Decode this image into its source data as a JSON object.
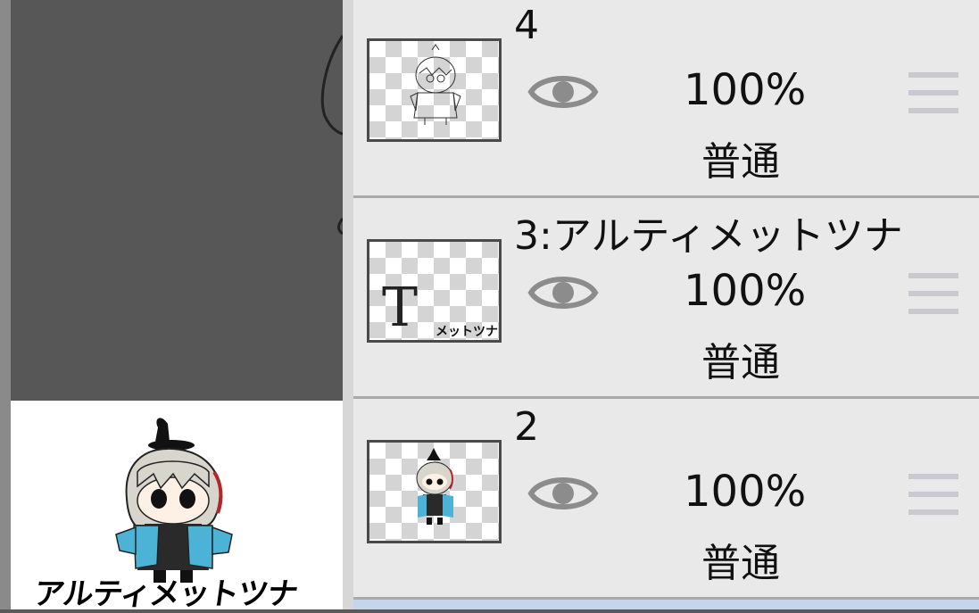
{
  "preview": {
    "caption": "アルティメットツナ"
  },
  "layers": [
    {
      "name": "4",
      "opacity": "100%",
      "blend": "普通",
      "thumb_icon": "sketch-thumbnail"
    },
    {
      "name": "3:アルティメットツナ",
      "opacity": "100%",
      "blend": "普通",
      "thumb_icon": "text-layer-thumbnail",
      "thumb_letter": "T",
      "thumb_text": "メットツナ"
    },
    {
      "name": "2",
      "opacity": "100%",
      "blend": "普通",
      "thumb_icon": "character-thumbnail"
    }
  ],
  "icons": {
    "visibility": "eye-icon",
    "reorder": "drag-handle-icon"
  },
  "colors": {
    "panel_bg": "#e9e9e9",
    "canvas_bg": "#575757",
    "selected_row": "#c5d5ea",
    "handle": "#c9c9cf",
    "eye": "#8c8c8c"
  }
}
